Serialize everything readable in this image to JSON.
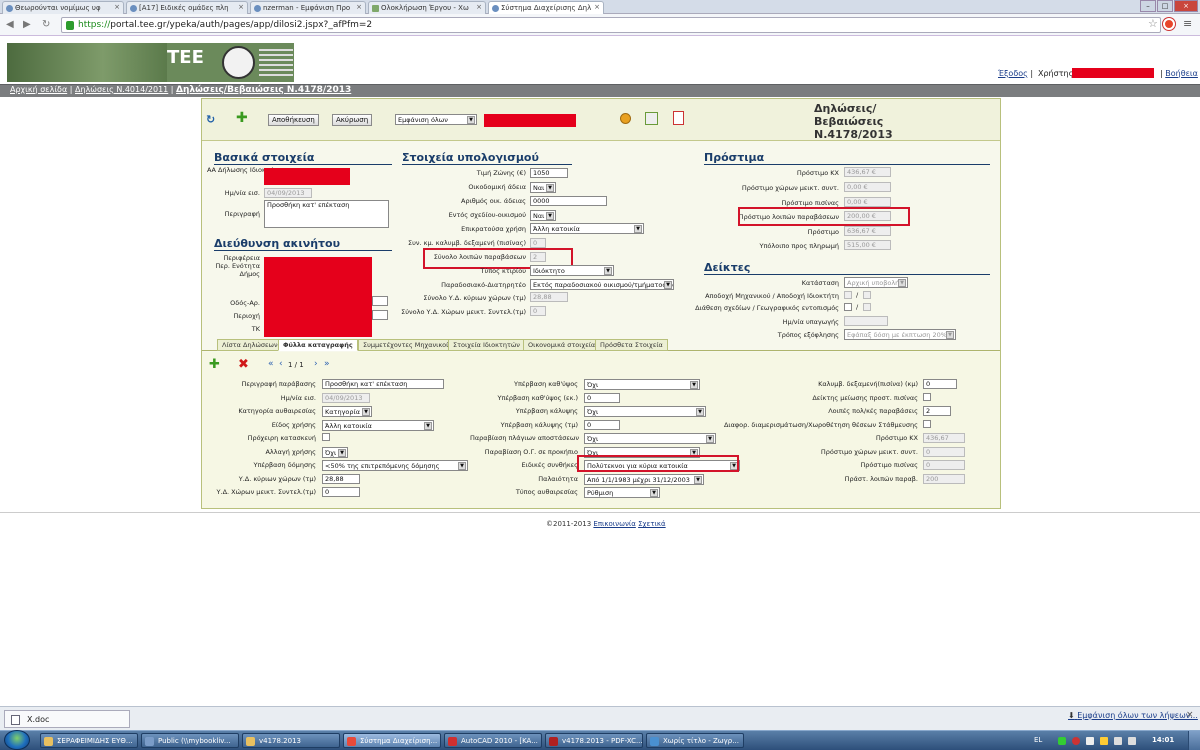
{
  "browser": {
    "tabs": [
      {
        "label": "Θεωρούνται νομίμως υφ"
      },
      {
        "label": "[A17] Ειδικές ομάδες πλη"
      },
      {
        "label": "nzerman - Εμφάνιση Προ"
      },
      {
        "label": "Ολοκλήρωση Έργου - Χω"
      },
      {
        "label": "Σύστημα Διαχείρισης Δηλ"
      }
    ],
    "url_scheme": "https://",
    "url_rest": "portal.tee.gr/ypeka/auth/pages/app/dilosi2.jspx?_afPfm=2"
  },
  "site": {
    "logo_text": "TEE",
    "logout": "Έξοδος",
    "user_label": "Χρήστης:",
    "help": "Βοήθεια",
    "breadcrumb": [
      "Αρχική σελίδα",
      "Δηλώσεις Ν.4014/2011",
      "Δηλώσεις/Βεβαιώσεις Ν.4178/2013"
    ]
  },
  "toolbar": {
    "save": "Αποθήκευση",
    "cancel": "Ακύρωση",
    "view_select": "Εμφάνιση όλων",
    "title_lines": [
      "Δηλώσεις/",
      "Βεβαιώσεις",
      "Ν.4178/2013"
    ]
  },
  "basic": {
    "header": "Βασικά στοιχεία",
    "owner_label": "ΑΑ Δήλωσης Ιδιοκτήτη",
    "owner_label2": "Ιδιοκτήτη",
    "date_label": "Ημ/νία εισ.",
    "date_value": "04/09/2013",
    "desc_label": "Περιγραφή",
    "desc_value": "Προσθήκη κατ' επέκταση"
  },
  "address": {
    "header": "Διεύθυνση ακινήτου",
    "labels": [
      "Περιφέρεια",
      "Περ. Ενότητα",
      "Δήμος",
      "Οδός-Αρ.",
      "Περιοχή",
      "ΤΚ"
    ]
  },
  "calc": {
    "header": "Στοιχεία υπολογισμού",
    "zone_price_label": "Τιμή Ζώνης (€)",
    "zone_price": "1050",
    "permit_label": "Οικοδομική άδεια",
    "permit": "Ναι",
    "permit_no_label": "Αριθμός οικ. άδειας",
    "permit_no": "0000",
    "inside_plan_label": "Εντός σχεδίου-οικισμού",
    "inside_plan": "Ναι",
    "main_use_label": "Επικρατούσα χρήση",
    "main_use": "Άλλη κατοικία",
    "coef_label": "Συν. κμ. καλυμβ. δεξαμενή (πισίνας)",
    "coef": "0",
    "total_other_label": "Σύνολο λοιπών παραβάσεων",
    "total_other": "2",
    "building_type_label": "Τύπος κτιρίου",
    "building_type": "Ιδιόκτητο",
    "traditional_label": "Παραδοσιακό-Διατηρητέο",
    "traditional": "Εκτός παραδοσιακού οικισμού/τμήματος πόλης",
    "total_main_label": "Σύνολο Υ.Δ. κύριων χώρων (τμ)",
    "total_main": "28,88",
    "total_aux_label": "Σύνολο Υ.Δ. Χώρων μεικτ. Συντελ.(τμ)",
    "total_aux": "0"
  },
  "fines": {
    "header": "Πρόστιμα",
    "rows": [
      {
        "label": "Πρόστιμο ΚΧ",
        "value": "436,67 €"
      },
      {
        "label": "Πρόστιμο χώρων μεικτ. συντ.",
        "value": "0,00 €"
      },
      {
        "label": "Πρόστιμο πισίνας",
        "value": "0,00 €"
      },
      {
        "label": "Πρόστιμο λοιπών παραβάσεων",
        "value": "200,00 €"
      },
      {
        "label": "Πρόστιμο",
        "value": "636,67 €"
      },
      {
        "label": "Υπόλοιπο προς πληρωμή",
        "value": "515,00 €"
      }
    ]
  },
  "indicators": {
    "header": "Δείκτες",
    "status_label": "Κατάσταση",
    "status": "Αρχική υποβολή",
    "accept_label": "Αποδοχή Μηχανικού / Αποδοχή Ιδιοκτήτη",
    "plans_label": "Διάθεση σχεδίων / Γεωγραφικός εντοπισμός",
    "submit_date_label": "Ημ/νία υπαγωγής",
    "payment_label": "Τρόπος εξόφλησης",
    "payment": "Εφάπαξ δόση με έκπτωση 20%"
  },
  "pagetabs": [
    "Λίστα Δηλώσεων",
    "Φύλλα καταγραφής",
    "Συμμετέχοντες Μηχανικοί",
    "Στοιχεία Ιδιοκτητών",
    "Οικονομικά στοιχεία",
    "Πρόσθετα Στοιχεία"
  ],
  "detail": {
    "pager": "1 / 1",
    "col1": [
      {
        "label": "Περιγραφή παράβασης",
        "value": "Προσθήκη κατ' επέκταση",
        "kind": "inp"
      },
      {
        "label": "Ημ/νία εισ.",
        "value": "04/09/2013",
        "kind": "ro"
      },
      {
        "label": "Κατηγορία αυθαιρεσίας",
        "value": "Κατηγορία 5",
        "kind": "sel"
      },
      {
        "label": "Είδος χρήσης",
        "value": "Άλλη κατοικία",
        "kind": "sel"
      },
      {
        "label": "Πρόχειρη κατασκευή",
        "value": "",
        "kind": "cb"
      },
      {
        "label": "Αλλαγή χρήσης",
        "value": "Όχι",
        "kind": "sel"
      },
      {
        "label": "Υπέρβαση δόμησης",
        "value": "<50% της επιτρεπόμενης δόμησης",
        "kind": "sel"
      },
      {
        "label": "Υ.Δ. κύριων χώρων (τμ)",
        "value": "28,88",
        "kind": "inp"
      },
      {
        "label": "Υ.Δ. Χώρων μεικτ. Συντελ.(τμ)",
        "value": "0",
        "kind": "inp"
      }
    ],
    "col2": [
      {
        "label": "Υπέρβαση καθ'ύψος",
        "value": "Όχι",
        "kind": "sel"
      },
      {
        "label": "Υπέρβαση καθ'ύψος (εκ.)",
        "value": "0",
        "kind": "inp"
      },
      {
        "label": "Υπέρβαση κάλυψης",
        "value": "Όχι",
        "kind": "sel"
      },
      {
        "label": "Υπέρβαση κάλυψης (τμ)",
        "value": "0",
        "kind": "inp"
      },
      {
        "label": "Παραβίαση πλάγιων αποστάσεων",
        "value": "Όχι",
        "kind": "sel"
      },
      {
        "label": "Παραβίαση Ο.Γ. σε προκήπιο",
        "value": "Όχι",
        "kind": "sel"
      },
      {
        "label": "Ειδικές συνθήκες",
        "value": "Πολύτεκνοι για κύρια κατοικία",
        "kind": "sel"
      },
      {
        "label": "Παλαιότητα",
        "value": "Από 1/1/1983 μέχρι 31/12/2003",
        "kind": "sel"
      },
      {
        "label": "Τύπος αυθαιρεσίας",
        "value": "Ρύθμιση",
        "kind": "sel"
      }
    ],
    "col3": [
      {
        "label": "Καλυμβ. δεξαμενή(πισίνα) (κμ)",
        "value": "0",
        "kind": "inp"
      },
      {
        "label": "Δείκτης μείωσης προστ. πισίνας",
        "value": "",
        "kind": "cb"
      },
      {
        "label": "Λοιπές πολ/κές παραβάσεις",
        "value": "2",
        "kind": "inp"
      },
      {
        "label": "Διαφορ. διαμερισμάτωση/Χωροθέτηση θέσεων Στάθμευσης",
        "value": "",
        "kind": "cb"
      },
      {
        "label": "Πρόστιμο ΚΧ",
        "value": "436,67",
        "kind": "ro"
      },
      {
        "label": "Πρόστιμο χώρων μεικτ. συντ.",
        "value": "0",
        "kind": "ro"
      },
      {
        "label": "Πρόστιμο πισίνας",
        "value": "0",
        "kind": "ro"
      },
      {
        "label": "Πράστ. λοιπών παραβ.",
        "value": "200",
        "kind": "ro"
      }
    ]
  },
  "footer": {
    "copy": "©2011-2013",
    "contact": "Επικοινωνία",
    "about": "Σχετικά"
  },
  "downloads": {
    "item": "X.doc",
    "show_all": "Εμφάνιση όλων των λήψεων..."
  },
  "taskbar": {
    "items": [
      "ΣΕΡΑΦΕΙΜΙΔΗΣ ΕΥΘ...",
      "Public (\\\\mybookliv...",
      "v4178.2013",
      "Σύστημα Διαχείριση...",
      "AutoCAD 2010 - [KA...",
      "v4178.2013 - PDF-XC...",
      "Χωρίς τίτλο - Ζωγρ..."
    ],
    "lang": "EL",
    "time": "14:01"
  }
}
